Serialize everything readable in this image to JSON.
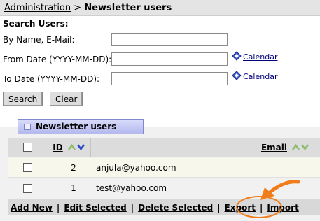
{
  "breadcrumb": {
    "parent": "Administration",
    "separator": ">",
    "current": "Newsletter users"
  },
  "search": {
    "title": "Search Users:",
    "name_label": "By Name, E-Mail:",
    "from_label": "From Date (YYYY-MM-DD):",
    "to_label": "To Date (YYYY-MM-DD):",
    "name_value": "",
    "from_value": "",
    "to_value": "",
    "calendar_label": "Calendar",
    "search_button": "Search",
    "clear_button": "Clear"
  },
  "grid": {
    "tab_label": "Newsletter users",
    "columns": {
      "id": "ID",
      "email": "Email"
    },
    "rows": [
      {
        "id": "2",
        "email": "anjula@yahoo.com"
      },
      {
        "id": "1",
        "email": "test@yahoo.com"
      }
    ],
    "sort_asc_color": "#8fbc6e",
    "sort_desc_color": "#2a48c8"
  },
  "actions": {
    "add": "Add New",
    "edit": "Edit Selected",
    "delete": "Delete Selected",
    "export": "Export",
    "import": "Import",
    "separator": "|"
  },
  "highlight": {
    "target": "Import",
    "color": "#f07d1a"
  }
}
